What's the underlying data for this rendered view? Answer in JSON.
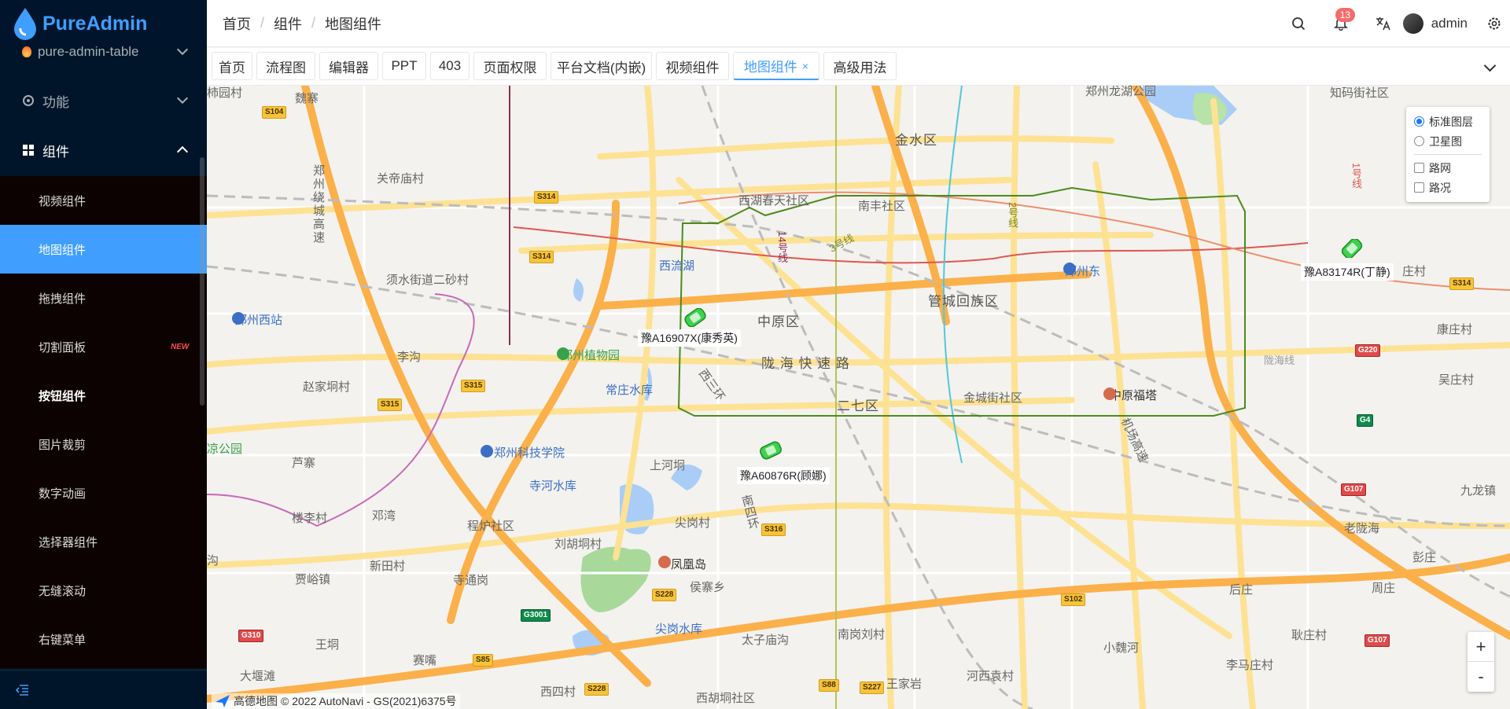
{
  "app": {
    "name": "PureAdmin"
  },
  "sidebar": {
    "top_item": "pure-admin-table",
    "menu": [
      {
        "label": "功能",
        "icon": "gear-icon"
      },
      {
        "label": "组件",
        "icon": "grid-icon"
      }
    ],
    "submenu": [
      {
        "label": "视频组件"
      },
      {
        "label": "地图组件",
        "active": true
      },
      {
        "label": "拖拽组件"
      },
      {
        "label": "切割面板",
        "badge": "NEW"
      },
      {
        "label": "按钮组件"
      },
      {
        "label": "图片裁剪"
      },
      {
        "label": "数字动画"
      },
      {
        "label": "选择器组件"
      },
      {
        "label": "无缝滚动"
      },
      {
        "label": "右键菜单"
      }
    ]
  },
  "header": {
    "breadcrumb": [
      "首页",
      "组件",
      "地图组件"
    ],
    "notifications": "13",
    "user": "admin"
  },
  "tabs": [
    "首页",
    "流程图",
    "编辑器",
    "PPT",
    "403",
    "页面权限",
    "平台文档(内嵌)",
    "视频组件",
    "地图组件",
    "高级用法"
  ],
  "map": {
    "layers": {
      "standard": "标准图层",
      "satellite": "卫星图",
      "roadnet": "路网",
      "traffic": "路况"
    },
    "zoom_in": "+",
    "zoom_out": "-",
    "copyright_brand": "高德地图",
    "copyright": "© 2022 AutoNavi - GS(2021)6375号",
    "cars": [
      {
        "label": "豫A16907X(康秀英)"
      },
      {
        "label": "豫A60876R(顾娜)"
      },
      {
        "label": "豫A83174R(丁静)"
      }
    ],
    "labels": {
      "l1": "郑州龙湖公园",
      "l2": "知码街社区",
      "l3": "金水区",
      "l4": "西湖春天社区",
      "l5": "南丰社区",
      "l6": "关帝庙村",
      "l7": "西流湖",
      "l8": "须水街道二砂村",
      "l9": "郑州西站",
      "l10": "中原区",
      "l11": "管城回族区",
      "l12": "陇 海 快 速 路",
      "l13": "郑州植物园",
      "l14": "常庄水库",
      "l15": "李沟",
      "l16": "赵家坰村",
      "l17": "二七区",
      "l18": "金城街社区",
      "l19": "中原福塔",
      "l20": "郑州科技学院",
      "l21": "芦寨",
      "l22": "寺河水库",
      "l23": "上河坰",
      "l24": "楼李村",
      "l25": "邓湾",
      "l26": "程炉社区",
      "l27": "尖岗村",
      "l28": "刘胡垌村",
      "l29": "凤凰岛",
      "l30": "新田村",
      "l31": "贾峪镇",
      "l32": "寺通岗",
      "l33": "侯寨乡",
      "l34": "尖岗水库",
      "l35": "王垌",
      "l36": "太子庙沟",
      "l37": "南岗刘村",
      "l38": "赛嘴",
      "l39": "大堰滩",
      "l40": "西四村",
      "l41": "西胡垌社区",
      "l42": "王家岩",
      "l43": "河西袁村",
      "l44": "小魏河",
      "l45": "李马庄村",
      "l46": "后庄",
      "l47": "耿庄村",
      "l48": "老陇海",
      "l49": "彭庄",
      "l50": "周庄",
      "l51": "九龙镇",
      "l52": "康庄村",
      "l53": "吴庄村",
      "l54": "魏寨",
      "l55": "郑州东",
      "l56": "庄村",
      "l57": "柿园村",
      "l58": "郑州绕城高速",
      "l59": "西三环",
      "l60": "南四环",
      "l61": "机场高速",
      "l62": "3号线",
      "l63": "2号线",
      "l64": "14号线",
      "l65": "1号线",
      "l66": "陇海线",
      "l67": "凉公园",
      "l68": "沟"
    },
    "shields": {
      "s1": "S104",
      "s2": "S314",
      "s3": "S314",
      "s4": "S315",
      "s5": "S315",
      "s6": "S316",
      "s7": "S228",
      "s8": "G3001",
      "s9": "S85",
      "s10": "S228",
      "s11": "S88",
      "s12": "S227",
      "s13": "G310",
      "s14": "S102",
      "s15": "G220",
      "s16": "G4",
      "s17": "G107",
      "s18": "G107",
      "s19": "S314"
    }
  }
}
